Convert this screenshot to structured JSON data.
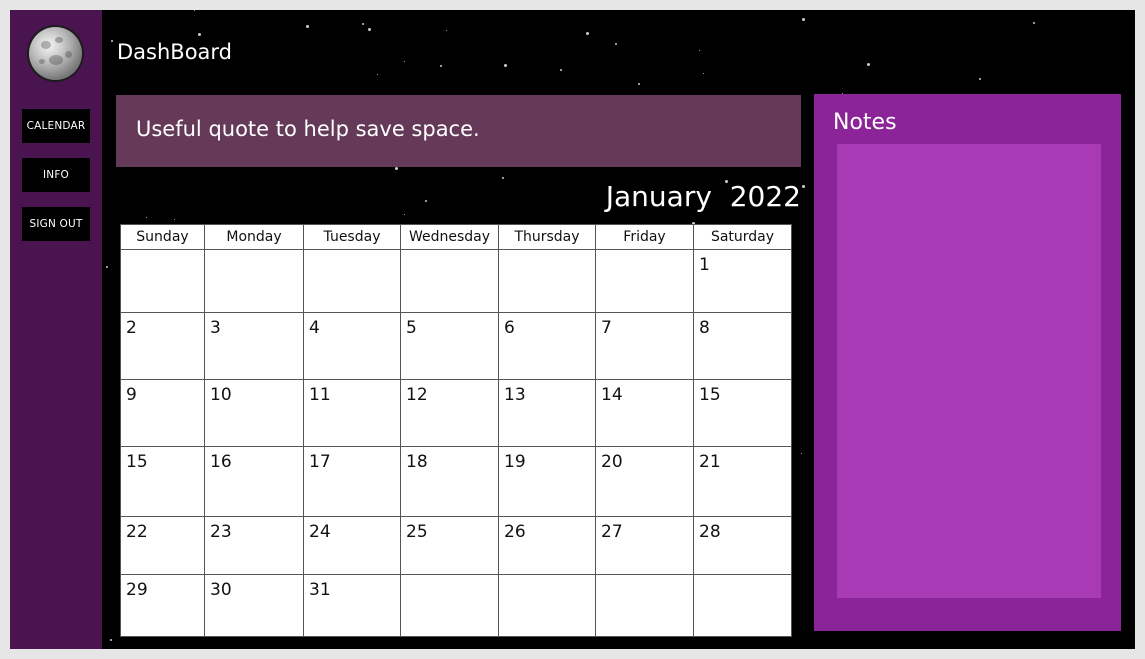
{
  "app": {
    "title": "DashBoard",
    "colors": {
      "sidebar": "#4a1450",
      "background": "#000000",
      "quote_box": "#653a58",
      "notes_panel": "#8b2499",
      "notes_area": "#a83ab6"
    }
  },
  "sidebar": {
    "avatar_icon": "moon-icon",
    "items": [
      {
        "label": "CALENDAR"
      },
      {
        "label": "INFO"
      },
      {
        "label": "SIGN OUT"
      }
    ]
  },
  "quote": {
    "text": "Useful quote to help save space."
  },
  "calendar": {
    "month": "January",
    "year": "2022",
    "weekdays": [
      "Sunday",
      "Monday",
      "Tuesday",
      "Wednesday",
      "Thursday",
      "Friday",
      "Saturday"
    ],
    "weeks": [
      [
        "",
        "",
        "",
        "",
        "",
        "",
        "1"
      ],
      [
        "2",
        "3",
        "4",
        "5",
        "6",
        "7",
        "8"
      ],
      [
        "9",
        "10",
        "11",
        "12",
        "13",
        "14",
        "15"
      ],
      [
        "15",
        "16",
        "17",
        "18",
        "19",
        "20",
        "21"
      ],
      [
        "22",
        "23",
        "24",
        "25",
        "26",
        "27",
        "28"
      ],
      [
        "29",
        "30",
        "31",
        "",
        "",
        "",
        ""
      ]
    ]
  },
  "notes": {
    "title": "Notes",
    "value": ""
  }
}
